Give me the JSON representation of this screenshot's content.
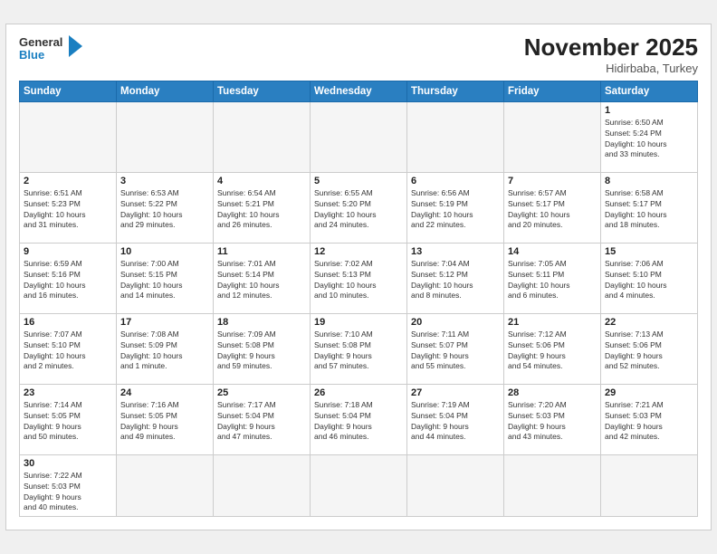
{
  "header": {
    "logo_general": "General",
    "logo_blue": "Blue",
    "month_title": "November 2025",
    "subtitle": "Hidirbaba, Turkey"
  },
  "days_of_week": [
    "Sunday",
    "Monday",
    "Tuesday",
    "Wednesday",
    "Thursday",
    "Friday",
    "Saturday"
  ],
  "weeks": [
    [
      {
        "day": "",
        "empty": true
      },
      {
        "day": "",
        "empty": true
      },
      {
        "day": "",
        "empty": true
      },
      {
        "day": "",
        "empty": true
      },
      {
        "day": "",
        "empty": true
      },
      {
        "day": "",
        "empty": true
      },
      {
        "day": "1",
        "info": "Sunrise: 6:50 AM\nSunset: 5:24 PM\nDaylight: 10 hours\nand 33 minutes."
      }
    ],
    [
      {
        "day": "2",
        "info": "Sunrise: 6:51 AM\nSunset: 5:23 PM\nDaylight: 10 hours\nand 31 minutes."
      },
      {
        "day": "3",
        "info": "Sunrise: 6:53 AM\nSunset: 5:22 PM\nDaylight: 10 hours\nand 29 minutes."
      },
      {
        "day": "4",
        "info": "Sunrise: 6:54 AM\nSunset: 5:21 PM\nDaylight: 10 hours\nand 26 minutes."
      },
      {
        "day": "5",
        "info": "Sunrise: 6:55 AM\nSunset: 5:20 PM\nDaylight: 10 hours\nand 24 minutes."
      },
      {
        "day": "6",
        "info": "Sunrise: 6:56 AM\nSunset: 5:19 PM\nDaylight: 10 hours\nand 22 minutes."
      },
      {
        "day": "7",
        "info": "Sunrise: 6:57 AM\nSunset: 5:17 PM\nDaylight: 10 hours\nand 20 minutes."
      },
      {
        "day": "8",
        "info": "Sunrise: 6:58 AM\nSunset: 5:17 PM\nDaylight: 10 hours\nand 18 minutes."
      }
    ],
    [
      {
        "day": "9",
        "info": "Sunrise: 6:59 AM\nSunset: 5:16 PM\nDaylight: 10 hours\nand 16 minutes."
      },
      {
        "day": "10",
        "info": "Sunrise: 7:00 AM\nSunset: 5:15 PM\nDaylight: 10 hours\nand 14 minutes."
      },
      {
        "day": "11",
        "info": "Sunrise: 7:01 AM\nSunset: 5:14 PM\nDaylight: 10 hours\nand 12 minutes."
      },
      {
        "day": "12",
        "info": "Sunrise: 7:02 AM\nSunset: 5:13 PM\nDaylight: 10 hours\nand 10 minutes."
      },
      {
        "day": "13",
        "info": "Sunrise: 7:04 AM\nSunset: 5:12 PM\nDaylight: 10 hours\nand 8 minutes."
      },
      {
        "day": "14",
        "info": "Sunrise: 7:05 AM\nSunset: 5:11 PM\nDaylight: 10 hours\nand 6 minutes."
      },
      {
        "day": "15",
        "info": "Sunrise: 7:06 AM\nSunset: 5:10 PM\nDaylight: 10 hours\nand 4 minutes."
      }
    ],
    [
      {
        "day": "16",
        "info": "Sunrise: 7:07 AM\nSunset: 5:10 PM\nDaylight: 10 hours\nand 2 minutes."
      },
      {
        "day": "17",
        "info": "Sunrise: 7:08 AM\nSunset: 5:09 PM\nDaylight: 10 hours\nand 1 minute."
      },
      {
        "day": "18",
        "info": "Sunrise: 7:09 AM\nSunset: 5:08 PM\nDaylight: 9 hours\nand 59 minutes."
      },
      {
        "day": "19",
        "info": "Sunrise: 7:10 AM\nSunset: 5:08 PM\nDaylight: 9 hours\nand 57 minutes."
      },
      {
        "day": "20",
        "info": "Sunrise: 7:11 AM\nSunset: 5:07 PM\nDaylight: 9 hours\nand 55 minutes."
      },
      {
        "day": "21",
        "info": "Sunrise: 7:12 AM\nSunset: 5:06 PM\nDaylight: 9 hours\nand 54 minutes."
      },
      {
        "day": "22",
        "info": "Sunrise: 7:13 AM\nSunset: 5:06 PM\nDaylight: 9 hours\nand 52 minutes."
      }
    ],
    [
      {
        "day": "23",
        "info": "Sunrise: 7:14 AM\nSunset: 5:05 PM\nDaylight: 9 hours\nand 50 minutes."
      },
      {
        "day": "24",
        "info": "Sunrise: 7:16 AM\nSunset: 5:05 PM\nDaylight: 9 hours\nand 49 minutes."
      },
      {
        "day": "25",
        "info": "Sunrise: 7:17 AM\nSunset: 5:04 PM\nDaylight: 9 hours\nand 47 minutes."
      },
      {
        "day": "26",
        "info": "Sunrise: 7:18 AM\nSunset: 5:04 PM\nDaylight: 9 hours\nand 46 minutes."
      },
      {
        "day": "27",
        "info": "Sunrise: 7:19 AM\nSunset: 5:04 PM\nDaylight: 9 hours\nand 44 minutes."
      },
      {
        "day": "28",
        "info": "Sunrise: 7:20 AM\nSunset: 5:03 PM\nDaylight: 9 hours\nand 43 minutes."
      },
      {
        "day": "29",
        "info": "Sunrise: 7:21 AM\nSunset: 5:03 PM\nDaylight: 9 hours\nand 42 minutes."
      }
    ],
    [
      {
        "day": "30",
        "info": "Sunrise: 7:22 AM\nSunset: 5:03 PM\nDaylight: 9 hours\nand 40 minutes."
      },
      {
        "day": "",
        "empty": true
      },
      {
        "day": "",
        "empty": true
      },
      {
        "day": "",
        "empty": true
      },
      {
        "day": "",
        "empty": true
      },
      {
        "day": "",
        "empty": true
      },
      {
        "day": "",
        "empty": true
      }
    ]
  ]
}
